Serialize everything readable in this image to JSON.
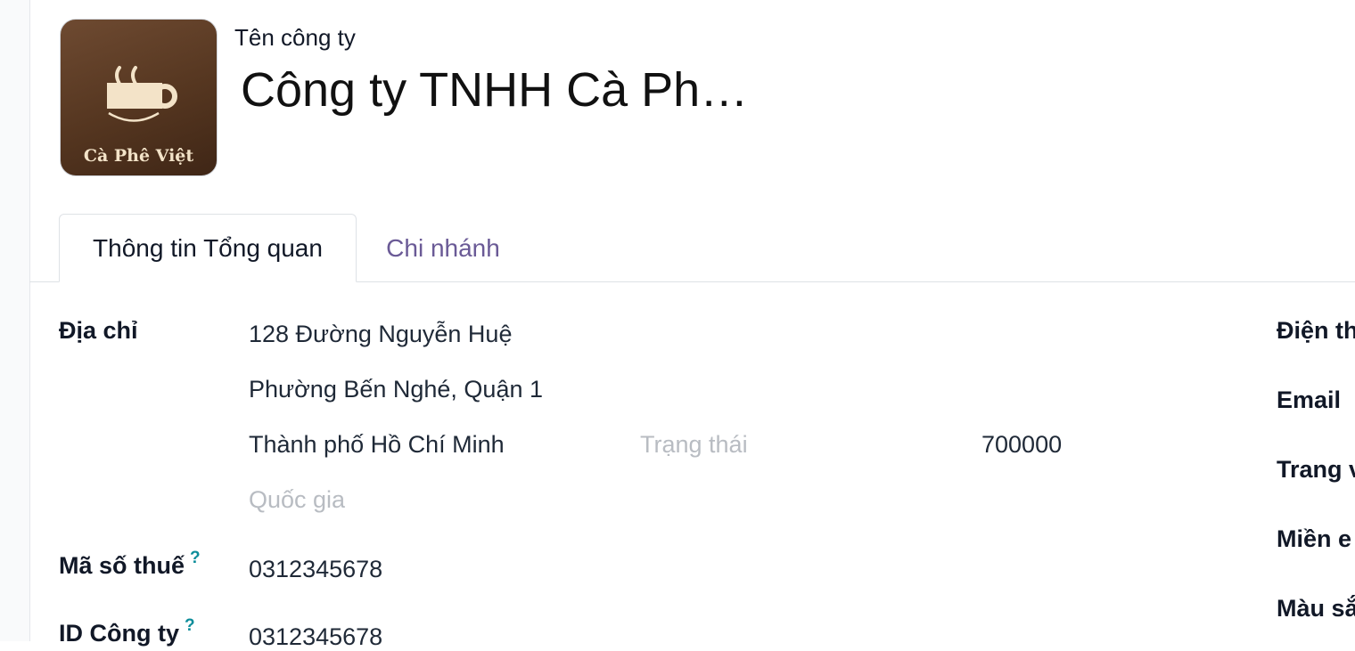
{
  "header": {
    "company_label": "Tên công ty",
    "company_name": "Công ty TNHH Cà Ph…",
    "logo_text": "Cà Phê Việt",
    "logo_icon": "coffee-cup-icon"
  },
  "tabs": [
    {
      "label": "Thông tin Tổng quan",
      "active": true
    },
    {
      "label": "Chi nhánh",
      "active": false
    }
  ],
  "address": {
    "label": "Địa chỉ",
    "street": "128 Đường Nguyễn Huệ",
    "street2": "Phường Bến Nghé, Quận 1",
    "city": "Thành phố Hồ Chí Minh",
    "state_placeholder": "Trạng thái",
    "zip": "700000",
    "country_placeholder": "Quốc gia"
  },
  "tax": {
    "label": "Mã số thuế",
    "help": "?",
    "value": "0312345678"
  },
  "company_id": {
    "label": "ID Công ty",
    "help": "?",
    "value": "0312345678"
  },
  "right_labels": {
    "phone": "Điện th",
    "email": "Email",
    "website": "Trang v",
    "domain": "Miền e",
    "color": "Màu sắ"
  },
  "colors": {
    "tab_inactive": "#6a5a96",
    "help": "#0d8d9a",
    "logo_bg": "#553620",
    "logo_fg": "#f3e3c8"
  }
}
